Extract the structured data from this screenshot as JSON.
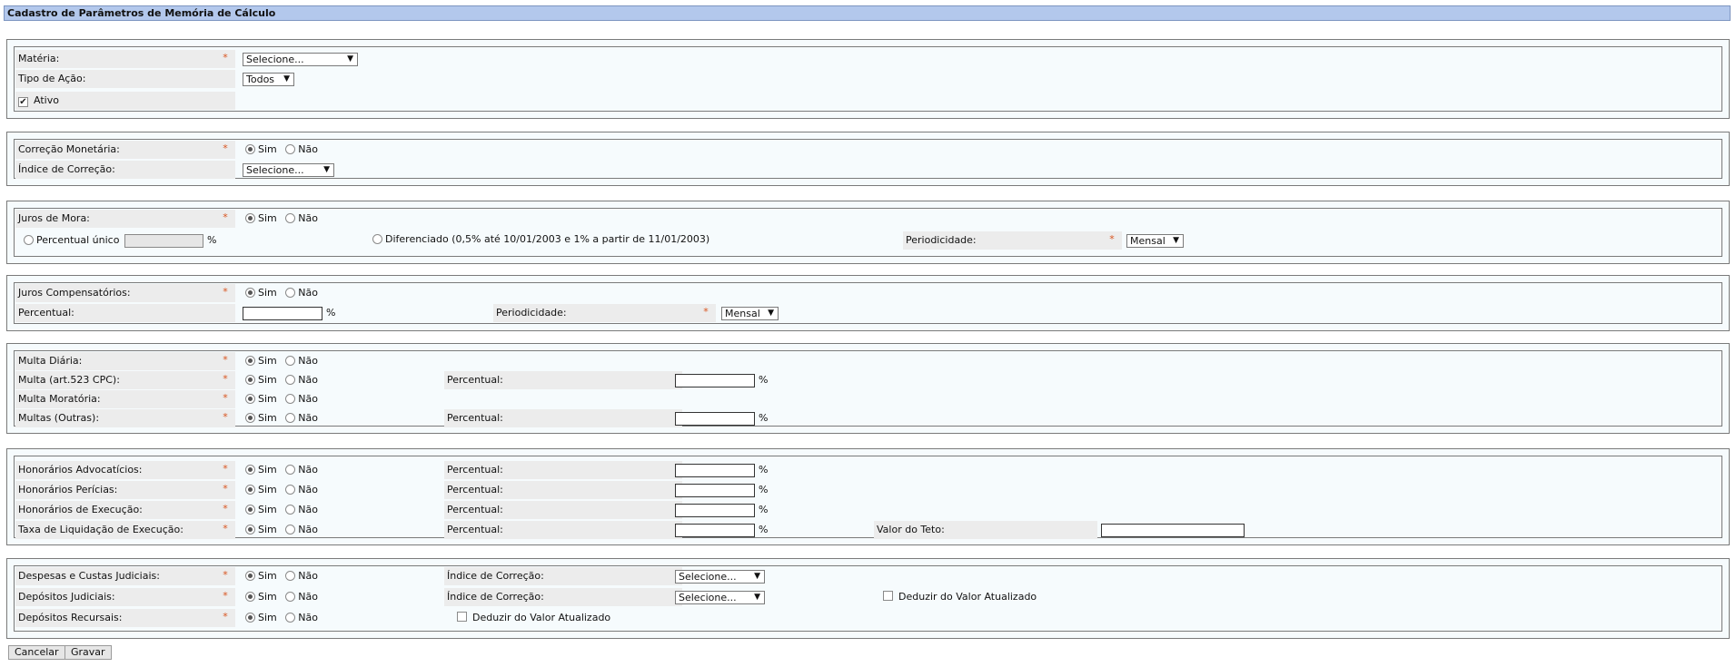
{
  "page": {
    "title": "Cadastro de Parâmetros de Memória de Cálculo"
  },
  "radio": {
    "sim": "Sim",
    "nao": "Não"
  },
  "general": {
    "materia_label": "Matéria:",
    "materia_value": "Selecione...",
    "tipo_acao_label": "Tipo de Ação:",
    "tipo_acao_value": "Todos",
    "ativo_label": "Ativo",
    "ativo_checked": true
  },
  "correcao": {
    "label": "Correção Monetária:",
    "indice_label": "Índice de Correção:",
    "indice_value": "Selecione..."
  },
  "juros_mora": {
    "label": "Juros de Mora:",
    "percentual_unico_label": "Percentual único",
    "percent_sign": "%",
    "diferenciado_label": "Diferenciado (0,5% até 10/01/2003 e 1% a partir de 11/01/2003)",
    "periodicidade_label": "Periodicidade:",
    "periodicidade_value": "Mensal"
  },
  "juros_comp": {
    "label": "Juros Compensatórios:",
    "percentual_label": "Percentual:",
    "percent_sign": "%",
    "periodicidade_label": "Periodicidade:",
    "periodicidade_value": "Mensal"
  },
  "multas": {
    "diaria_label": "Multa Diária:",
    "art523_label": "Multa (art.523 CPC):",
    "moratoria_label": "Multa Moratória:",
    "outras_label": "Multas (Outras):",
    "percentual_label": "Percentual:",
    "percent_sign": "%"
  },
  "honorarios": {
    "advocaticios_label": "Honorários Advocatícios:",
    "pericias_label": "Honorários Perícias:",
    "execucao_label": "Honorários de Execução:",
    "taxa_label": "Taxa de Liquidação de Execução:",
    "percentual_label": "Percentual:",
    "percent_sign": "%",
    "valor_teto_label": "Valor do Teto:"
  },
  "despesas": {
    "custas_label": "Despesas e Custas Judiciais:",
    "depositos_judiciais_label": "Depósitos Judiciais:",
    "depositos_recursais_label": "Depósitos Recursais:",
    "indice_label": "Índice de Correção:",
    "indice_value": "Selecione...",
    "deduzir_label": "Deduzir do Valor Atualizado"
  },
  "buttons": {
    "cancelar": "Cancelar",
    "gravar": "Gravar"
  },
  "colors": {
    "title_bg": "#b3c8ec",
    "required": "#d9531e",
    "label_bg": "#ececec",
    "panel_bg": "#f6fbfd"
  }
}
